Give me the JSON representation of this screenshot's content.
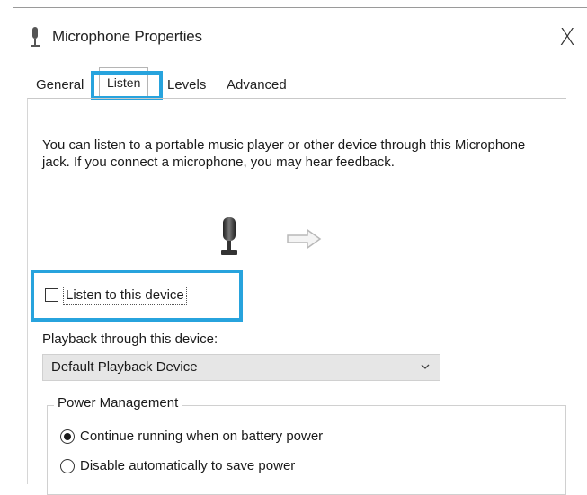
{
  "window": {
    "title": "Microphone Properties",
    "close_label": "X",
    "icon": "microphone-icon"
  },
  "tabs": [
    {
      "label": "General",
      "selected": false
    },
    {
      "label": "Listen",
      "selected": true
    },
    {
      "label": "Levels",
      "selected": false
    },
    {
      "label": "Advanced",
      "selected": false
    }
  ],
  "listen": {
    "description": "You can listen to a portable music player or other device through this Microphone jack.  If you connect a microphone, you may hear feedback.",
    "illustration": {
      "left_icon": "microphone-icon",
      "right_icon": "right-arrow-icon"
    },
    "checkbox": {
      "label": "Listen to this device",
      "checked": false
    },
    "playback_label": "Playback through this device:",
    "playback_device": {
      "selected": "Default Playback Device"
    },
    "power_management": {
      "title": "Power Management",
      "options": [
        {
          "label": "Continue running when on battery power",
          "selected": true
        },
        {
          "label": "Disable automatically to save power",
          "selected": false
        }
      ]
    }
  },
  "colors": {
    "highlight": "#27a3dd",
    "dropdown_bg": "#e6e6e6"
  }
}
